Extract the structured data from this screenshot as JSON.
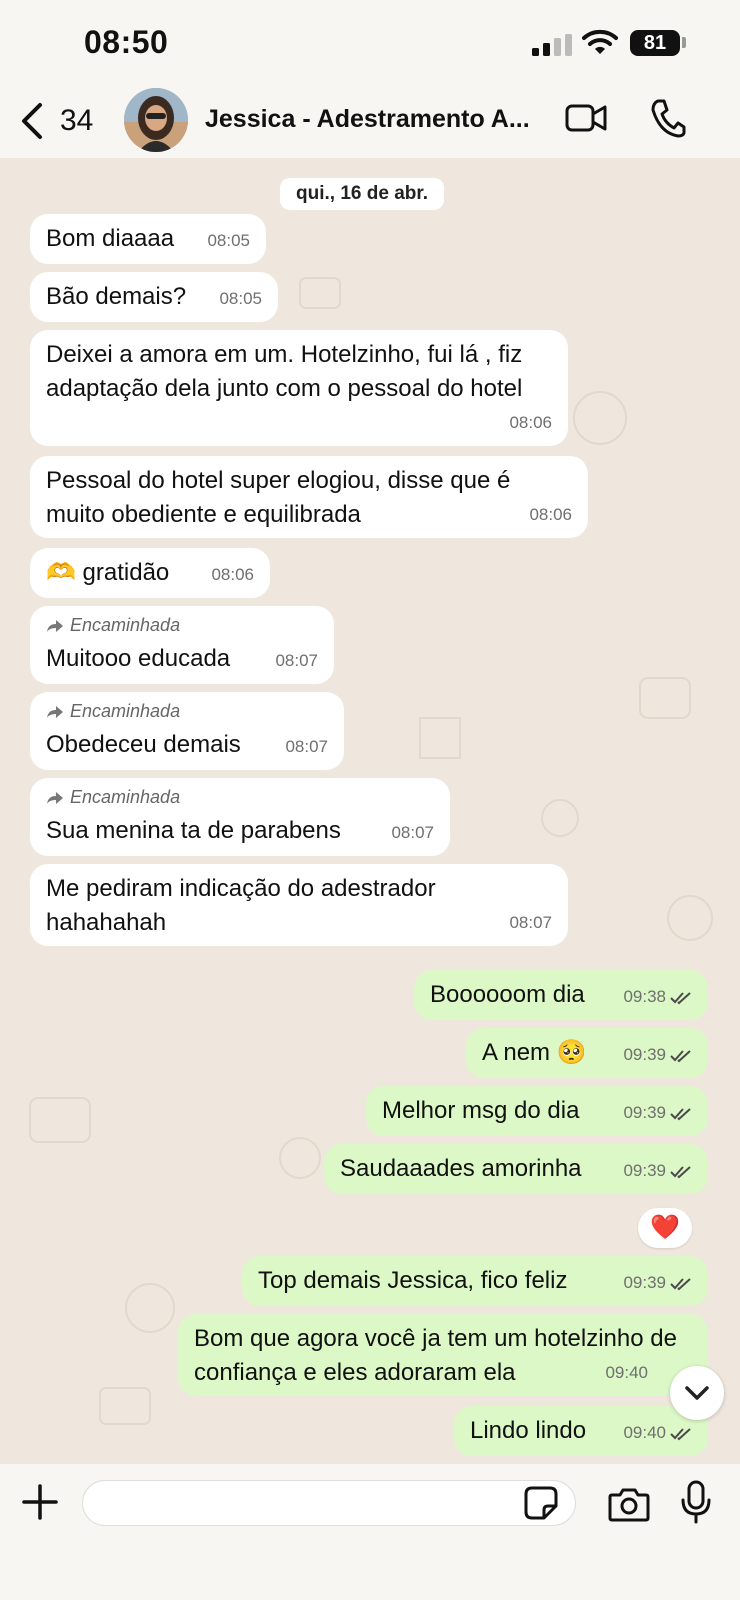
{
  "status_bar": {
    "time": "08:50",
    "battery": "81"
  },
  "header": {
    "back_count": "34",
    "contact_name": "Jessica - Adestramento A..."
  },
  "chat": {
    "date_label": "qui., 16 de abr.",
    "forwarded_label": "Encaminhada",
    "messages": [
      {
        "text": "Bom diaaaa",
        "time": "08:05"
      },
      {
        "text": "Bão demais?",
        "time": "08:05"
      },
      {
        "text": "Deixei a amora em um. Hotelzinho,  fui lá , fiz adaptação dela junto com o pessoal do hotel",
        "time": "08:06"
      },
      {
        "text": "Pessoal do hotel super elogiou,  disse que é muito obediente e equilibrada",
        "time": "08:06"
      },
      {
        "text": "🫶 gratidão",
        "time": "08:06"
      },
      {
        "text": "Muitooo educada",
        "time": "08:07"
      },
      {
        "text": "Obedeceu demais",
        "time": "08:07"
      },
      {
        "text": "Sua menina ta de parabens",
        "time": "08:07"
      },
      {
        "text": "Me pediram indicação do adestrador hahahahah",
        "time": "08:07"
      },
      {
        "text": "Boooooom dia",
        "time": "09:38"
      },
      {
        "text": "A nem 🥺",
        "time": "09:39"
      },
      {
        "text": "Melhor msg do dia",
        "time": "09:39"
      },
      {
        "text": "Saudaaades amorinha",
        "time": "09:39"
      },
      {
        "text": "Top demais Jessica, fico feliz",
        "time": "09:39"
      },
      {
        "text": "Bom que agora você ja tem um hotelzinho de confiança e eles adoraram ela",
        "time": "09:40"
      },
      {
        "text": "Lindo lindo",
        "time": "09:40"
      }
    ],
    "reaction": "❤️"
  },
  "colors": {
    "incoming": "#ffffff",
    "outgoing": "#dcf8c6",
    "read_ticks": "#4a4a4a"
  },
  "icons": [
    "chevron-left-icon",
    "video-camera-icon",
    "phone-icon",
    "forward-arrow-icon",
    "double-check-icon",
    "chevron-down-icon",
    "plus-icon",
    "sticker-icon",
    "camera-icon",
    "microphone-icon"
  ]
}
